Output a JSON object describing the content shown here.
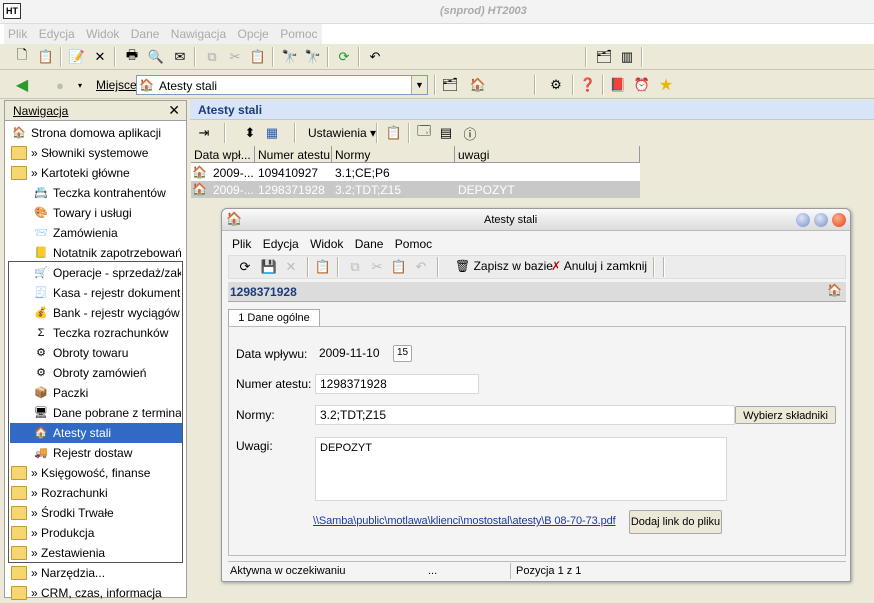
{
  "app": {
    "logo_text": "HT",
    "title": "(snprod)  HT2003"
  },
  "menubar": {
    "items": [
      "Plik",
      "Edycja",
      "Widok",
      "Dane",
      "Nawigacja",
      "Opcje",
      "Pomoc"
    ]
  },
  "location": {
    "label": "Miejsce",
    "value": "Atesty stali"
  },
  "nav": {
    "title": "Nawigacja",
    "close": "✕",
    "items": [
      {
        "label": "Strona domowa aplikacji",
        "kind": "home-icon"
      },
      {
        "label": "» Słowniki systemowe",
        "kind": "folder-icon"
      },
      {
        "label": "» Kartoteki główne",
        "kind": "folder-open-icon"
      },
      {
        "label": "Teczka kontrahentów",
        "kind": "contacts-icon"
      },
      {
        "label": "Towary i usługi",
        "kind": "goods-icon"
      },
      {
        "label": "Zamówienia",
        "kind": "orders-icon"
      },
      {
        "label": "Notatnik zapotrzebowań",
        "kind": "notebook-icon"
      },
      {
        "label": "Operacje - sprzedaż/zak...",
        "kind": "operations-icon"
      },
      {
        "label": "Kasa - rejestr dokumentó...",
        "kind": "cashbox-icon"
      },
      {
        "label": "Bank - rejestr wyciągów ...",
        "kind": "bank-icon"
      },
      {
        "label": "Teczka rozrachunków",
        "kind": "sigma-icon"
      },
      {
        "label": "Obroty towaru",
        "kind": "turnover-icon"
      },
      {
        "label": "Obroty zamówień",
        "kind": "order-turnover-icon"
      },
      {
        "label": "Paczki",
        "kind": "package-icon"
      },
      {
        "label": "Dane pobrane z terminal...",
        "kind": "terminal-icon"
      },
      {
        "label": "Atesty stali",
        "kind": "house-icon"
      },
      {
        "label": "Rejestr dostaw",
        "kind": "delivery-icon"
      },
      {
        "label": "» Księgowość, finanse",
        "kind": "folder-icon"
      },
      {
        "label": "» Rozrachunki",
        "kind": "folder-icon"
      },
      {
        "label": "» Środki Trwałe",
        "kind": "folder-icon"
      },
      {
        "label": "» Produkcja",
        "kind": "folder-icon"
      },
      {
        "label": "» Zestawienia",
        "kind": "folder-icon"
      },
      {
        "label": "» Narzędzia...",
        "kind": "folder-icon"
      },
      {
        "label": "» CRM, czas, informacja",
        "kind": "folder-icon"
      }
    ]
  },
  "main": {
    "title": "Atesty stali",
    "settings_label": "Ustawienia ▾",
    "columns": [
      "Data wpł...",
      "Numer atestu",
      "Normy",
      "uwagi"
    ],
    "rows": [
      {
        "date": "2009-...",
        "number": "109410927",
        "norms": "3.1;CE;P6",
        "notes": ""
      },
      {
        "date": "2009-...",
        "number": "1298371928",
        "norms": "3.2;TDT;Z15",
        "notes": "DEPOZYT"
      }
    ]
  },
  "dialog": {
    "title": "Atesty stali",
    "menu": [
      "Plik",
      "Edycja",
      "Widok",
      "Dane",
      "Pomoc"
    ],
    "save_label": "Zapisz w bazie",
    "cancel_label": "Anuluj i zamknij",
    "record_header": "1298371928",
    "tab_label": "1 Dane ogólne",
    "date_label": "Data wpływu:",
    "date_value": "2009-11-10",
    "date_btn": "15",
    "number_label": "Numer atestu:",
    "number_value": "1298371928",
    "norms_label": "Normy:",
    "norms_value": "3.2;TDT;Z15",
    "choose_btn": "Wybierz składniki",
    "notes_label": "Uwagi:",
    "notes_value": "DEPOZYT",
    "file_link": "\\\\Samba\\public\\motlawa\\klienci\\mostostal\\atesty\\B 08-70-73.pdf",
    "add_link_btn": "Dodaj link do pliku",
    "status_left": "Aktywna w oczekiwaniu",
    "status_mid": "...",
    "status_right": "Pozycja 1 z 1"
  }
}
